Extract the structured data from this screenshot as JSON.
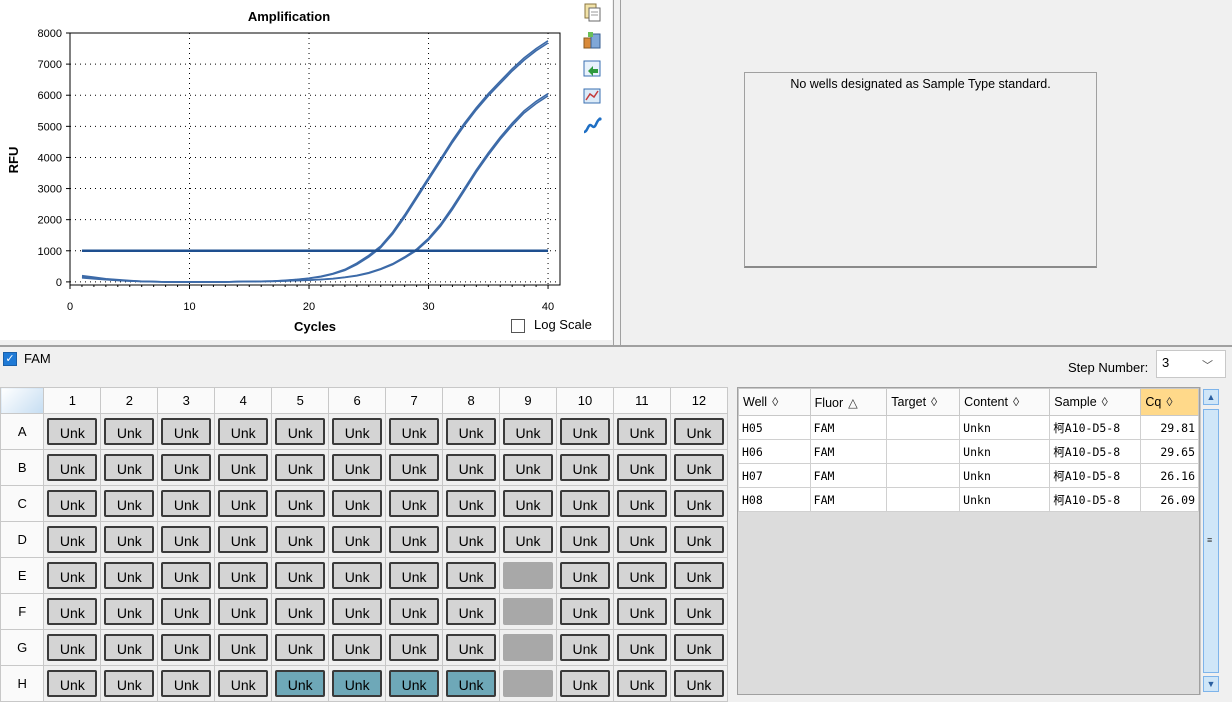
{
  "chart": {
    "log_scale_label": "Log Scale"
  },
  "chart_data": {
    "type": "line",
    "title": "Amplification",
    "xlabel": "Cycles",
    "ylabel": "RFU",
    "xlim": [
      0,
      41
    ],
    "ylim": [
      -100,
      8000
    ],
    "xticks": [
      0,
      10,
      20,
      30,
      40
    ],
    "yticks": [
      0,
      1000,
      2000,
      3000,
      4000,
      5000,
      6000,
      7000,
      8000
    ],
    "grid": "dotted",
    "threshold": 1000,
    "x": [
      1,
      2,
      3,
      4,
      5,
      6,
      7,
      8,
      9,
      10,
      11,
      12,
      13,
      14,
      15,
      16,
      17,
      18,
      19,
      20,
      21,
      22,
      23,
      24,
      25,
      26,
      27,
      28,
      29,
      30,
      31,
      32,
      33,
      34,
      35,
      36,
      37,
      38,
      39,
      40
    ],
    "series": [
      {
        "values": [
          200,
          150,
          100,
          70,
          40,
          20,
          10,
          0,
          0,
          0,
          0,
          0,
          0,
          10,
          15,
          20,
          30,
          50,
          80,
          120,
          180,
          270,
          400,
          600,
          850,
          1150,
          1600,
          2150,
          2750,
          3350,
          3950,
          4550,
          5100,
          5600,
          6050,
          6450,
          6850,
          7200,
          7500,
          7750
        ]
      },
      {
        "values": [
          150,
          110,
          80,
          50,
          30,
          15,
          5,
          0,
          0,
          0,
          0,
          0,
          0,
          5,
          10,
          15,
          20,
          30,
          45,
          60,
          80,
          110,
          150,
          210,
          300,
          420,
          580,
          800,
          1050,
          1400,
          1850,
          2400,
          3000,
          3600,
          4150,
          4650,
          5100,
          5500,
          5800,
          6050
        ]
      },
      {
        "values": [
          170,
          130,
          90,
          60,
          35,
          18,
          8,
          0,
          0,
          0,
          0,
          0,
          0,
          8,
          12,
          18,
          28,
          45,
          72,
          110,
          165,
          250,
          370,
          560,
          800,
          1100,
          1540,
          2080,
          2680,
          3280,
          3880,
          4480,
          5030,
          5530,
          5980,
          6380,
          6780,
          7130,
          7430,
          7680
        ]
      },
      {
        "values": [
          130,
          100,
          70,
          45,
          25,
          12,
          4,
          0,
          0,
          0,
          0,
          0,
          0,
          4,
          8,
          12,
          18,
          27,
          40,
          55,
          75,
          100,
          140,
          195,
          280,
          400,
          560,
          770,
          1010,
          1350,
          1790,
          2330,
          2930,
          3530,
          4080,
          4580,
          5030,
          5430,
          5730,
          5980
        ]
      }
    ]
  },
  "standard_panel": {
    "message": "No wells designated as Sample Type standard."
  },
  "fluor_filter": {
    "label": "FAM",
    "checked": true
  },
  "step": {
    "label": "Step Number:",
    "value": "3"
  },
  "plate": {
    "columns": [
      "1",
      "2",
      "3",
      "4",
      "5",
      "6",
      "7",
      "8",
      "9",
      "10",
      "11",
      "12"
    ],
    "rows": [
      {
        "label": "A",
        "wells": [
          "Unk",
          "Unk",
          "Unk",
          "Unk",
          "Unk",
          "Unk",
          "Unk",
          "Unk",
          "Unk",
          "Unk",
          "Unk",
          "Unk"
        ]
      },
      {
        "label": "B",
        "wells": [
          "Unk",
          "Unk",
          "Unk",
          "Unk",
          "Unk",
          "Unk",
          "Unk",
          "Unk",
          "Unk",
          "Unk",
          "Unk",
          "Unk"
        ]
      },
      {
        "label": "C",
        "wells": [
          "Unk",
          "Unk",
          "Unk",
          "Unk",
          "Unk",
          "Unk",
          "Unk",
          "Unk",
          "Unk",
          "Unk",
          "Unk",
          "Unk"
        ]
      },
      {
        "label": "D",
        "wells": [
          "Unk",
          "Unk",
          "Unk",
          "Unk",
          "Unk",
          "Unk",
          "Unk",
          "Unk",
          "Unk",
          "Unk",
          "Unk",
          "Unk"
        ]
      },
      {
        "label": "E",
        "wells": [
          "Unk",
          "Unk",
          "Unk",
          "Unk",
          "Unk",
          "Unk",
          "Unk",
          "Unk",
          "",
          "Unk",
          "Unk",
          "Unk"
        ]
      },
      {
        "label": "F",
        "wells": [
          "Unk",
          "Unk",
          "Unk",
          "Unk",
          "Unk",
          "Unk",
          "Unk",
          "Unk",
          "",
          "Unk",
          "Unk",
          "Unk"
        ]
      },
      {
        "label": "G",
        "wells": [
          "Unk",
          "Unk",
          "Unk",
          "Unk",
          "Unk",
          "Unk",
          "Unk",
          "Unk",
          "",
          "Unk",
          "Unk",
          "Unk"
        ]
      },
      {
        "label": "H",
        "wells": [
          "Unk",
          "Unk",
          "Unk",
          "Unk",
          "Unk",
          "Unk",
          "Unk",
          "Unk",
          "",
          "Unk",
          "Unk",
          "Unk"
        ]
      }
    ],
    "selected_wells": [
      "H5",
      "H6",
      "H7",
      "H8"
    ]
  },
  "results": {
    "headers": [
      "Well",
      "Fluor",
      "Target",
      "Content",
      "Sample",
      "Cq"
    ],
    "sort_icons": [
      "◊",
      "△",
      "◊",
      "◊",
      "◊",
      "◊"
    ],
    "rows": [
      [
        "H05",
        "FAM",
        "",
        "Unkn",
        "柯A10-D5-8",
        "29.81"
      ],
      [
        "H06",
        "FAM",
        "",
        "Unkn",
        "柯A10-D5-8",
        "29.65"
      ],
      [
        "H07",
        "FAM",
        "",
        "Unkn",
        "柯A10-D5-8",
        "26.16"
      ],
      [
        "H08",
        "FAM",
        "",
        "Unkn",
        "柯A10-D5-8",
        "26.09"
      ]
    ]
  },
  "colors": {
    "curve": "#3c6aa8",
    "threshold": "#1e4f8f",
    "selected_well": "#6ea8b8",
    "cq_header": "#ffd98a"
  },
  "icons": [
    "copy-icon",
    "export-icon",
    "save-image-icon",
    "chart-options-icon",
    "curve-icon",
    "checkmark-icon",
    "dropdown-caret-icon",
    "sort-icon",
    "scroll-up-icon",
    "scroll-down-icon"
  ]
}
